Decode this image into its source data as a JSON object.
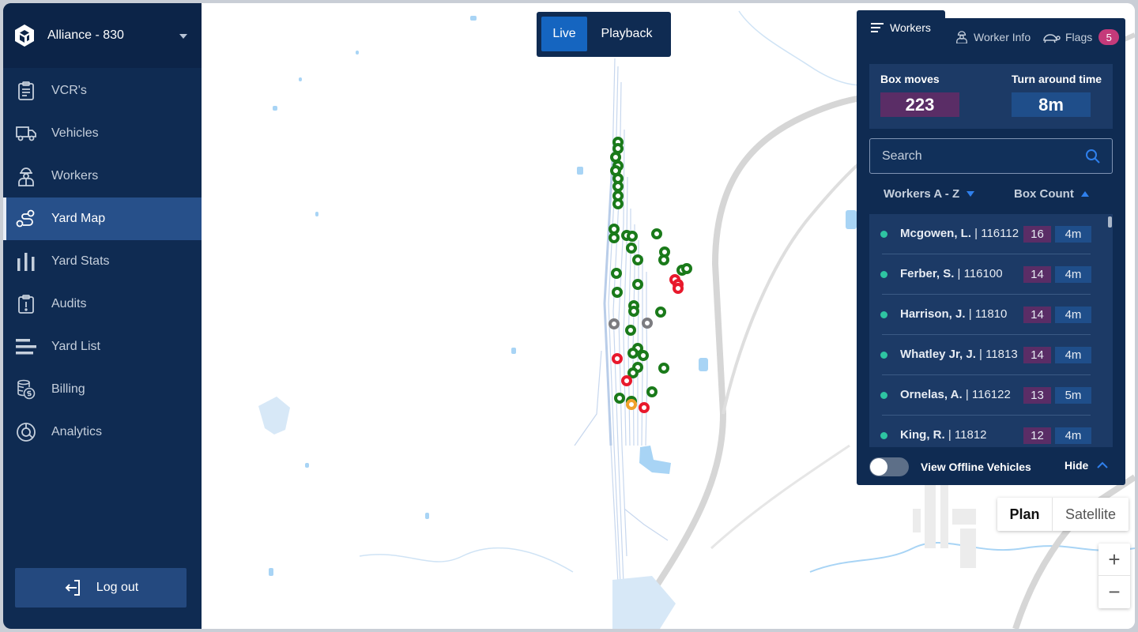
{
  "org": {
    "name": "Alliance - 830"
  },
  "nav": [
    {
      "label": "VCR's",
      "icon": "clipboard-icon"
    },
    {
      "label": "Vehicles",
      "icon": "truck-icon"
    },
    {
      "label": "Workers",
      "icon": "worker-icon"
    },
    {
      "label": "Yard Map",
      "icon": "route-icon"
    },
    {
      "label": "Yard Stats",
      "icon": "bar-chart-icon"
    },
    {
      "label": "Audits",
      "icon": "clipboard-alert-icon"
    },
    {
      "label": "Yard List",
      "icon": "list-icon"
    },
    {
      "label": "Billing",
      "icon": "coins-icon"
    },
    {
      "label": "Analytics",
      "icon": "pie-chart-icon"
    }
  ],
  "active_nav": "Yard Map",
  "logout_label": "Log out",
  "mode_toggle": {
    "live": "Live",
    "playback": "Playback",
    "selected": "Live"
  },
  "panel": {
    "tabs": {
      "workers": "Workers",
      "worker_info": "Worker Info",
      "flags": "Flags",
      "flags_count": "5"
    },
    "stats": {
      "box_moves_label": "Box moves",
      "box_moves": "223",
      "turnaround_label": "Turn around time",
      "turnaround": "8m"
    },
    "search_placeholder": "Search",
    "sort": {
      "name": "Workers A - Z",
      "count": "Box Count"
    },
    "workers": [
      {
        "name": "Mcgowen, L.",
        "id": "| 116112",
        "count": "16",
        "time": "4m"
      },
      {
        "name": "Ferber, S.",
        "id": "| 116100",
        "count": "14",
        "time": "4m"
      },
      {
        "name": "Harrison, J.",
        "id": "| 11810",
        "count": "14",
        "time": "4m"
      },
      {
        "name": "Whatley Jr, J.",
        "id": "| 11813",
        "count": "14",
        "time": "4m"
      },
      {
        "name": "Ornelas, A.",
        "id": "| 116122",
        "count": "13",
        "time": "5m"
      },
      {
        "name": "King, R.",
        "id": "| 11812",
        "count": "12",
        "time": "4m"
      }
    ],
    "offline_label": "View Offline Vehicles",
    "offline_enabled": false,
    "hide_label": "Hide"
  },
  "map_type": {
    "plan": "Plan",
    "satellite": "Satellite",
    "selected": "Plan"
  },
  "zoom": {
    "in": "+",
    "out": "−"
  },
  "colors": {
    "sidebar": "#0f2b52",
    "active": "#27508a",
    "vehicle_ok": "#1a7a1a",
    "vehicle_alert": "#e8192c",
    "vehicle_idle": "#7c7c80",
    "vehicle_warn": "#f0a12b",
    "count_badge": "#5a2d66",
    "time_badge": "#1f4e8a"
  }
}
